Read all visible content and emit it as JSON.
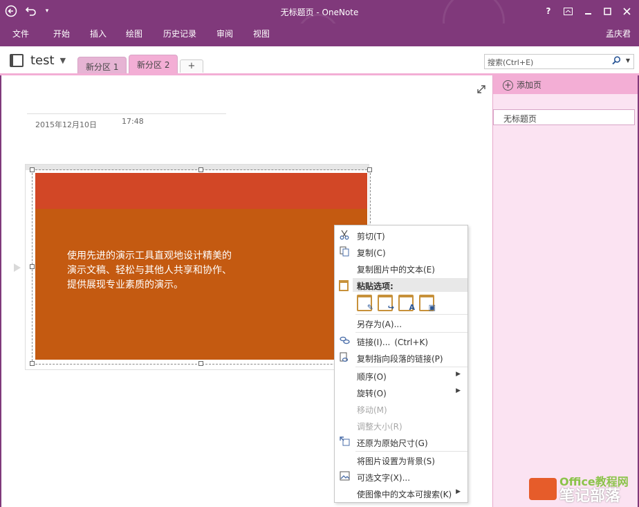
{
  "window": {
    "title": "无标题页 - OneNote",
    "back_icon": "back-arrow-icon",
    "undo_icon": "undo-icon",
    "help_label": "?",
    "controls": [
      "help-icon",
      "ribbon-display-icon",
      "minimize-icon",
      "maximize-icon",
      "close-icon"
    ]
  },
  "menu": {
    "items": [
      "文件",
      "开始",
      "插入",
      "绘图",
      "历史记录",
      "审阅",
      "视图"
    ],
    "user": "孟庆君"
  },
  "notebook": {
    "name": "test",
    "sections": [
      "新分区 1",
      "新分区 2"
    ],
    "add_section": "+"
  },
  "search": {
    "placeholder": "搜索(Ctrl+E)"
  },
  "page": {
    "date": "2015年12月10日",
    "time": "17:48",
    "slide_text": [
      "使用先进的演示工具直观地设计精美的",
      "演示文稿、轻松与其他人共享和协作、",
      "提供展现专业素质的演示。"
    ]
  },
  "pages_pane": {
    "add_page": "添加页",
    "pages": [
      "无标题页"
    ]
  },
  "context_menu": {
    "cut": "剪切(T)",
    "copy": "复制(C)",
    "copy_text": "复制图片中的文本(E)",
    "paste_header": "粘贴选项:",
    "save_as": "另存为(A)...",
    "link": "链接(I)...",
    "link_shortcut": "(Ctrl+K)",
    "copy_link": "复制指向段落的链接(P)",
    "order": "顺序(O)",
    "rotate": "旋转(O)",
    "move": "移动(M)",
    "resize": "调整大小(R)",
    "restore": "还原为原始尺寸(G)",
    "set_background": "将图片设置为背景(S)",
    "alt_text": "可选文字(X)...",
    "searchable": "使图像中的文本可搜索(K)"
  },
  "watermark": {
    "brand": "Office教程网",
    "name": "笔记部落"
  },
  "colors": {
    "title_bar": "#80397b",
    "section_tab_active": "#f3aed5",
    "slide_body": "#c45a11",
    "slide_header": "#d24726"
  }
}
